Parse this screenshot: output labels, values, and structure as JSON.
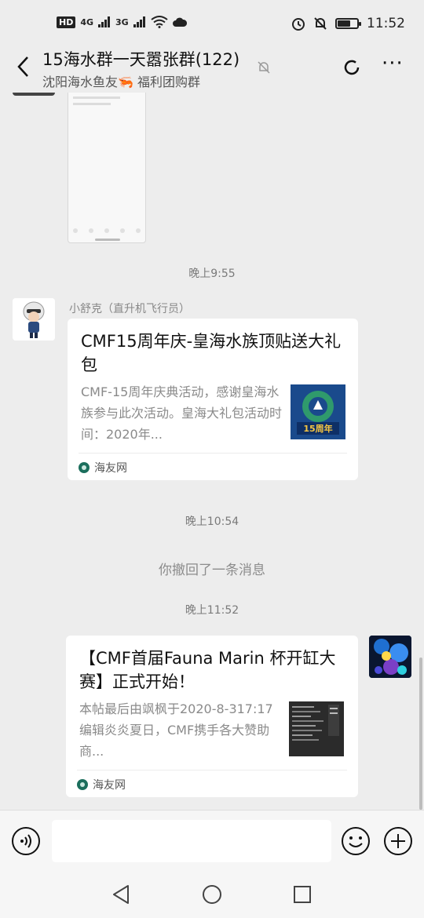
{
  "status_bar": {
    "left_labels": [
      "HD",
      "4G",
      "3G"
    ],
    "time": "11:52",
    "icons": [
      "signal-icon",
      "wifi-icon",
      "cloud-icon",
      "alarm-icon",
      "silent-icon",
      "battery-icon"
    ]
  },
  "header": {
    "title": "15海水群一天嚣张群(122)",
    "subtitle": "沈阳海水鱼友🦐 福利团购群"
  },
  "messages": [
    {
      "kind": "timestamp",
      "text": "晚上9:55"
    },
    {
      "kind": "link_card",
      "sender": "小舒克（直升机飞行员）",
      "title": "CMF15周年庆-皇海水族顶贴送大礼包",
      "desc": "CMF-15周年庆典活动，感谢皇海水族参与此次活动。皇海大礼包活动时间：2020年...",
      "source": "海友网",
      "thumb_text": "15周年"
    },
    {
      "kind": "timestamp",
      "text": "晚上10:54"
    },
    {
      "kind": "system",
      "text": "你撤回了一条消息"
    },
    {
      "kind": "timestamp",
      "text": "晚上11:52"
    },
    {
      "kind": "link_card",
      "sender": "",
      "title": "【CMF首届Fauna Marin 杯开缸大赛】正式开始！",
      "desc": "本帖最后由飒枫于2020-8-317:17编辑炎炎夏日，CMF携手各大赞助商...",
      "source": "海友网"
    }
  ],
  "colors": {
    "background": "#ededed",
    "card": "#ffffff",
    "muted_text": "#8a8a8a"
  }
}
